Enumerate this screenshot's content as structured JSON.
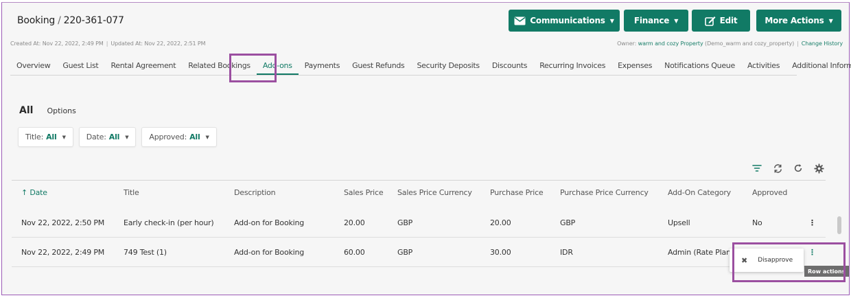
{
  "header": {
    "title": "Booking",
    "booking_id": "220-361-077",
    "created": "Created At: Nov 22, 2022, 2:49 PM",
    "updated": "Updated At: Nov 22, 2022, 2:51 PM",
    "owner_label": "Owner:",
    "owner_name": "warm and cozy Property",
    "owner_code": "(Demo_warm and cozy_property)",
    "change_history": "Change History"
  },
  "actions": {
    "communications": "Communications",
    "finance": "Finance",
    "edit": "Edit",
    "more_actions": "More Actions"
  },
  "tabs": [
    "Overview",
    "Guest List",
    "Rental Agreement",
    "Related Bookings",
    "Add-ons",
    "Payments",
    "Guest Refunds",
    "Security Deposits",
    "Discounts",
    "Recurring Invoices",
    "Expenses",
    "Notifications Queue",
    "Activities",
    "Additional Information"
  ],
  "active_tab": "Add-ons",
  "subtabs": {
    "all": "All",
    "options": "Options"
  },
  "filters": [
    {
      "label": "Title:",
      "value": "All"
    },
    {
      "label": "Date:",
      "value": "All"
    },
    {
      "label": "Approved:",
      "value": "All"
    }
  ],
  "columns": {
    "date": "Date",
    "title": "Title",
    "description": "Description",
    "sales_price": "Sales Price",
    "sales_price_currency": "Sales Price Currency",
    "purchase_price": "Purchase Price",
    "purchase_price_currency": "Purchase Price Currency",
    "category": "Add-On Category",
    "approved": "Approved"
  },
  "rows": [
    {
      "date": "Nov 22, 2022, 2:50 PM",
      "title": "Early check-in (per hour)",
      "description": "Add-on for Booking",
      "sales_price": "20.00",
      "sales_price_currency": "GBP",
      "purchase_price": "20.00",
      "purchase_price_currency": "GBP",
      "category": "Upsell",
      "approved": "No"
    },
    {
      "date": "Nov 22, 2022, 2:49 PM",
      "title": "749 Test (1)",
      "description": "Add-on for Booking",
      "sales_price": "60.00",
      "sales_price_currency": "GBP",
      "purchase_price": "30.00",
      "purchase_price_currency": "IDR",
      "category": "Admin (Rate Plan)",
      "approved": ""
    }
  ],
  "row_menu": {
    "disapprove": "Disapprove"
  },
  "tooltip": "Row actions",
  "colors": {
    "accent": "#117a65",
    "highlight": "#9b4fa0"
  },
  "icons": [
    "envelope-icon",
    "edit-icon",
    "filter-icon",
    "sync-icon",
    "refresh-icon",
    "gear-icon",
    "close-icon",
    "kebab-icon",
    "sort-up-icon"
  ]
}
